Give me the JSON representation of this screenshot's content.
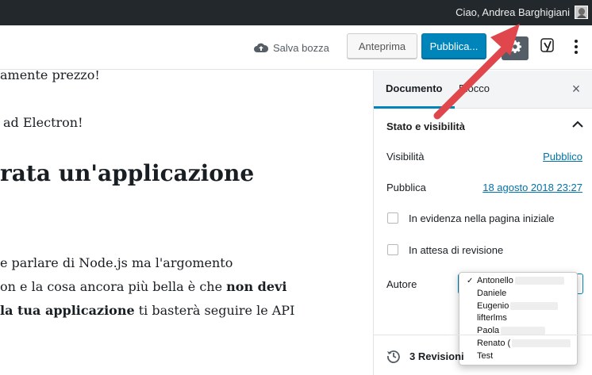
{
  "admin_bar": {
    "greeting": "Ciao, Andrea Barghigiani"
  },
  "header": {
    "save_draft_label": "Salva bozza",
    "preview_label": "Anteprima",
    "publish_label": "Pubblica..."
  },
  "content": {
    "line1": "amente prezzo!",
    "line2": "ad Electron!",
    "heading": "rata un'applicazione",
    "line3": "e parlare di Node.js ma l'argomento",
    "line4_a": "on e la cosa ancora più bella è che ",
    "line4_b": "non devi",
    "line5_a": "la tua applicazione",
    "line5_b": " ti basterà seguire le API"
  },
  "sidebar": {
    "tab_document": "Documento",
    "tab_block": "Blocco",
    "close_symbol": "×",
    "panel_title": "Stato e visibilità",
    "visibility_label": "Visibilità",
    "visibility_value": "Pubblico",
    "publish_label": "Pubblica",
    "publish_value": "18 agosto 2018 23:27",
    "sticky_label": "In evidenza nella pagina iniziale",
    "pending_label": "In attesa di revisione",
    "author_label": "Autore",
    "revisions_label": "3 Revisioni"
  },
  "author_options": [
    {
      "label": "Antonello",
      "selected": true
    },
    {
      "label": "Daniele",
      "selected": false
    },
    {
      "label": "Eugenio",
      "selected": false
    },
    {
      "label": "lifterlms",
      "selected": false
    },
    {
      "label": "Paola",
      "selected": false
    },
    {
      "label": "Renato (",
      "selected": false
    },
    {
      "label": "Test",
      "selected": false
    }
  ],
  "colors": {
    "admin_bar": "#23282d",
    "primary": "#0085ba",
    "link": "#0073aa",
    "annotation_arrow": "#e0474c"
  },
  "icons": {
    "save": "cloud-upload-icon",
    "settings": "gear-icon",
    "yoast": "yoast-icon",
    "more": "more-vertical-icon",
    "close": "close-icon",
    "collapse": "chevron-up-icon",
    "revisions": "history-icon",
    "selected": "checkmark-icon"
  }
}
